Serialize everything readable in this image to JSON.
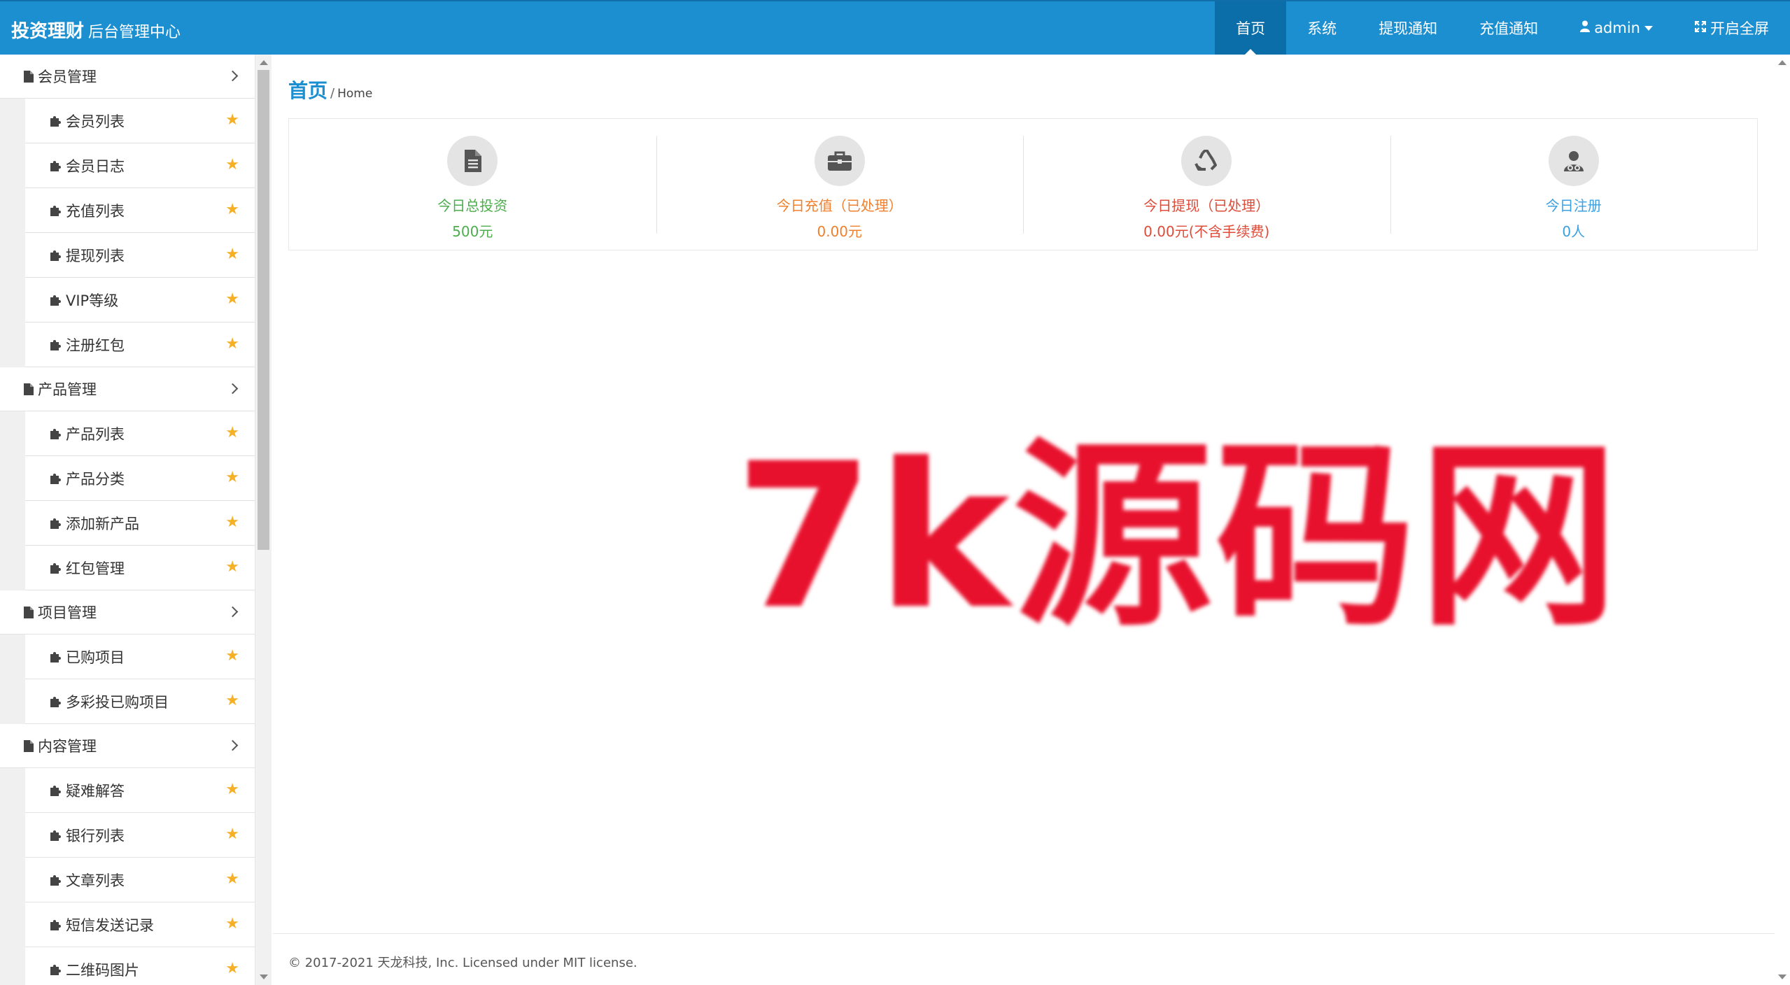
{
  "header": {
    "brand_main": "投资理财",
    "brand_sub": "后台管理中心",
    "nav": [
      {
        "label": "首页"
      },
      {
        "label": "系统"
      },
      {
        "label": "提现通知"
      },
      {
        "label": "充值通知"
      },
      {
        "label": "admin"
      },
      {
        "label": "开启全屏"
      }
    ]
  },
  "sidebar": {
    "groups": [
      {
        "label": "会员管理",
        "items": [
          {
            "label": "会员列表"
          },
          {
            "label": "会员日志"
          },
          {
            "label": "充值列表"
          },
          {
            "label": "提现列表"
          },
          {
            "label": "VIP等级"
          },
          {
            "label": "注册红包"
          }
        ]
      },
      {
        "label": "产品管理",
        "items": [
          {
            "label": "产品列表"
          },
          {
            "label": "产品分类"
          },
          {
            "label": "添加新产品"
          },
          {
            "label": "红包管理"
          }
        ]
      },
      {
        "label": "项目管理",
        "items": [
          {
            "label": "已购项目"
          },
          {
            "label": "多彩投已购项目"
          }
        ]
      },
      {
        "label": "内容管理",
        "items": [
          {
            "label": "疑难解答"
          },
          {
            "label": "银行列表"
          },
          {
            "label": "文章列表"
          },
          {
            "label": "短信发送记录"
          },
          {
            "label": "二维码图片"
          }
        ]
      }
    ]
  },
  "main": {
    "breadcrumb": {
      "title": "首页",
      "sep": "/",
      "sub": "Home"
    },
    "stats": [
      {
        "label": "今日总投资",
        "value": "500元",
        "icon": "file-text-icon",
        "color": "#4cae4c"
      },
      {
        "label": "今日充值（已处理）",
        "value": "0.00元",
        "icon": "briefcase-icon",
        "color": "#f0802e"
      },
      {
        "label": "今日提现（已处理）",
        "value": "0.00元(不含手续费)",
        "icon": "recycle-icon",
        "color": "#dd4b39"
      },
      {
        "label": "今日注册",
        "value": "0人",
        "icon": "user-md-icon",
        "color": "#3aa0e0"
      }
    ],
    "watermark": "7k源码网",
    "footer": "© 2017-2021 天龙科技, Inc. Licensed under MIT license."
  },
  "colors": {
    "navbar": "#1c8fd1",
    "nav_active": "#0c6ea8",
    "star": "#f5b025",
    "watermark": "#e8112d"
  }
}
